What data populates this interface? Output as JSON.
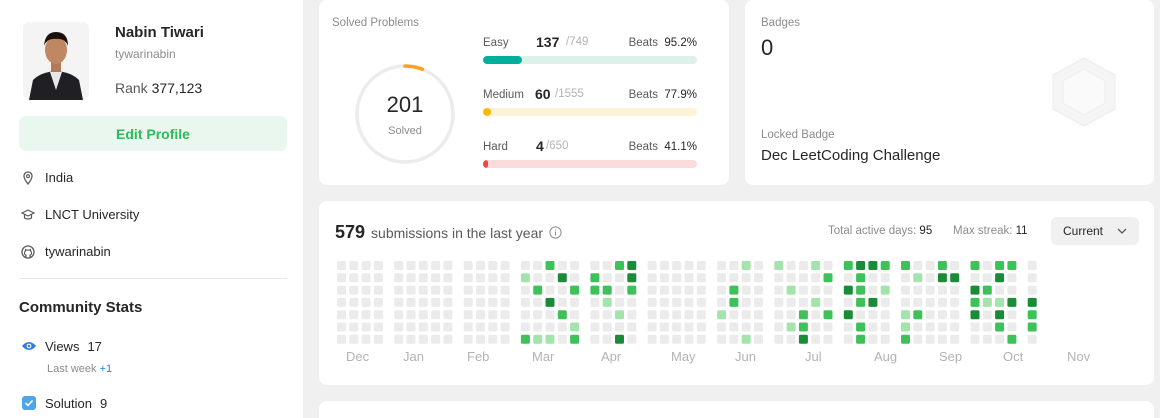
{
  "profile": {
    "name": "Nabin Tiwari",
    "username": "tywarinabin",
    "rank_label": "Rank",
    "rank_value": "377,123",
    "edit_label": "Edit Profile",
    "location": "India",
    "school": "LNCT University",
    "github": "tywarinabin"
  },
  "community": {
    "title": "Community Stats",
    "views_label": "Views",
    "views_value": "17",
    "last_week_label": "Last week",
    "last_week_delta": "+1",
    "solution_label": "Solution",
    "solution_value": "9"
  },
  "solved": {
    "label": "Solved Problems",
    "total": "201",
    "total_label": "Solved",
    "ring_progress": 0.059,
    "difficulties": [
      {
        "name": "Easy",
        "count": "137",
        "total": "/749",
        "beats_label": "Beats",
        "beats": "95.2%",
        "fraction": 0.183,
        "color": "#00af9b",
        "track": "#dcf2e8"
      },
      {
        "name": "Medium",
        "count": "60",
        "total": "/1555",
        "beats_label": "Beats",
        "beats": "77.9%",
        "fraction": 0.039,
        "color": "#ffb800",
        "track": "#fdf3d7"
      },
      {
        "name": "Hard",
        "count": "4",
        "total": "/650",
        "beats_label": "Beats",
        "beats": "41.1%",
        "fraction": 0.006,
        "color": "#ef4743",
        "track": "#fbdcdc"
      }
    ]
  },
  "badges": {
    "label": "Badges",
    "count": "0",
    "locked_label": "Locked Badge",
    "locked_name": "Dec LeetCoding Challenge"
  },
  "submissions": {
    "count": "579",
    "title": "submissions in the last year",
    "active_label": "Total active days:",
    "active_value": "95",
    "streak_label": "Max streak:",
    "streak_value": "11",
    "select_value": "Current",
    "months": [
      "Dec",
      "Jan",
      "Feb",
      "Mar",
      "Apr",
      "May",
      "Jun",
      "Jul",
      "Aug",
      "Sep",
      "Oct",
      "Nov"
    ]
  },
  "colors": {
    "accent_green": "#2cbb5d",
    "easy": "#00af9b",
    "medium": "#ffb800",
    "hard": "#ef4743",
    "heat_empty": "#ebebeb",
    "heat_1": "#a3e4ad",
    "heat_2": "#3fc15a",
    "heat_3": "#1a8c37"
  }
}
